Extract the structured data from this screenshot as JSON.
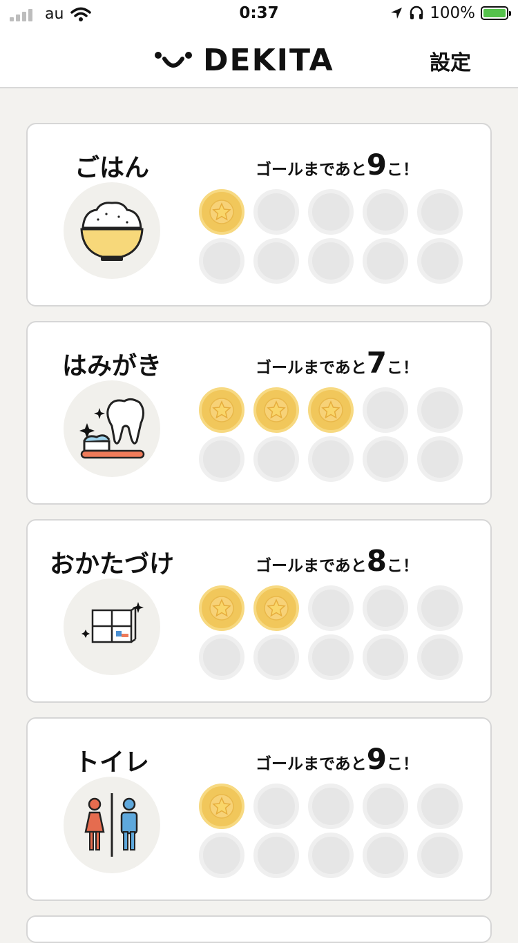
{
  "status_bar": {
    "carrier": "au",
    "time": "0:37",
    "battery": "100%"
  },
  "header": {
    "logo": "DEKITA",
    "settings_label": "設定"
  },
  "goal": {
    "prefix": "ゴールまであと",
    "suffix": "こ！"
  },
  "cards": [
    {
      "title": "ごはん",
      "remaining": "9",
      "completed": 1,
      "total": 10,
      "icon": "rice-bowl-icon"
    },
    {
      "title": "はみがき",
      "remaining": "7",
      "completed": 3,
      "total": 10,
      "icon": "tooth-brush-icon"
    },
    {
      "title": "おかたづけ",
      "remaining": "8",
      "completed": 2,
      "total": 10,
      "icon": "shelf-icon"
    },
    {
      "title": "トイレ",
      "remaining": "9",
      "completed": 1,
      "total": 10,
      "icon": "toilet-icon"
    }
  ],
  "colors": {
    "coin_filled": "#f1c75b",
    "coin_empty": "#e6e6e6",
    "background": "#f3f2ef",
    "battery": "#54c24b"
  }
}
